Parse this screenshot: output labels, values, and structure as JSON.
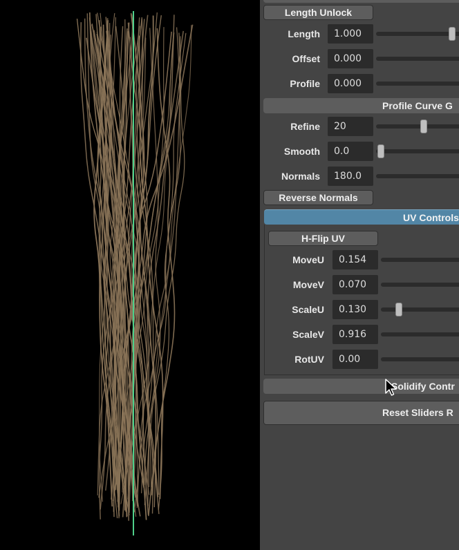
{
  "viewport": {
    "hair_color": "#8a7458",
    "axis_color": "#4fd08a",
    "background": "#000000"
  },
  "panel": {
    "length_unlock_label": "Length Unlock",
    "rows_top": [
      {
        "label": "Length",
        "value": "1.000",
        "slider_fraction": 1.0
      },
      {
        "label": "Offset",
        "value": "0.000",
        "slider_fraction": 0.0
      },
      {
        "label": "Profile",
        "value": "0.000",
        "slider_fraction": 0.0
      }
    ],
    "profile_curve_label": "Profile Curve G",
    "rows_profile": [
      {
        "label": "Refine",
        "value": "20",
        "slider_fraction": 0.6
      },
      {
        "label": "Smooth",
        "value": "0.0",
        "slider_fraction": 0.0
      },
      {
        "label": "Normals",
        "value": "180.0",
        "slider_fraction": 1.0
      }
    ],
    "reverse_normals_label": "Reverse Normals",
    "uv_controls_label": "UV Controls",
    "hflip_label": "H-Flip UV",
    "rows_uv": [
      {
        "label": "MoveU",
        "value": "0.154"
      },
      {
        "label": "MoveV",
        "value": "0.070"
      },
      {
        "label": "ScaleU",
        "value": "0.130",
        "slider_fraction": 0.13
      },
      {
        "label": "ScaleV",
        "value": "0.916"
      },
      {
        "label": "RotUV",
        "value": "0.00"
      }
    ],
    "solidify_label": "Solidify Contr",
    "reset_label": "Reset Sliders R"
  },
  "colors": {
    "panel_bg": "#444444",
    "button_bg": "#5d5d5d",
    "field_bg": "#2b2b2b",
    "accent_blue": "#5286a6"
  }
}
